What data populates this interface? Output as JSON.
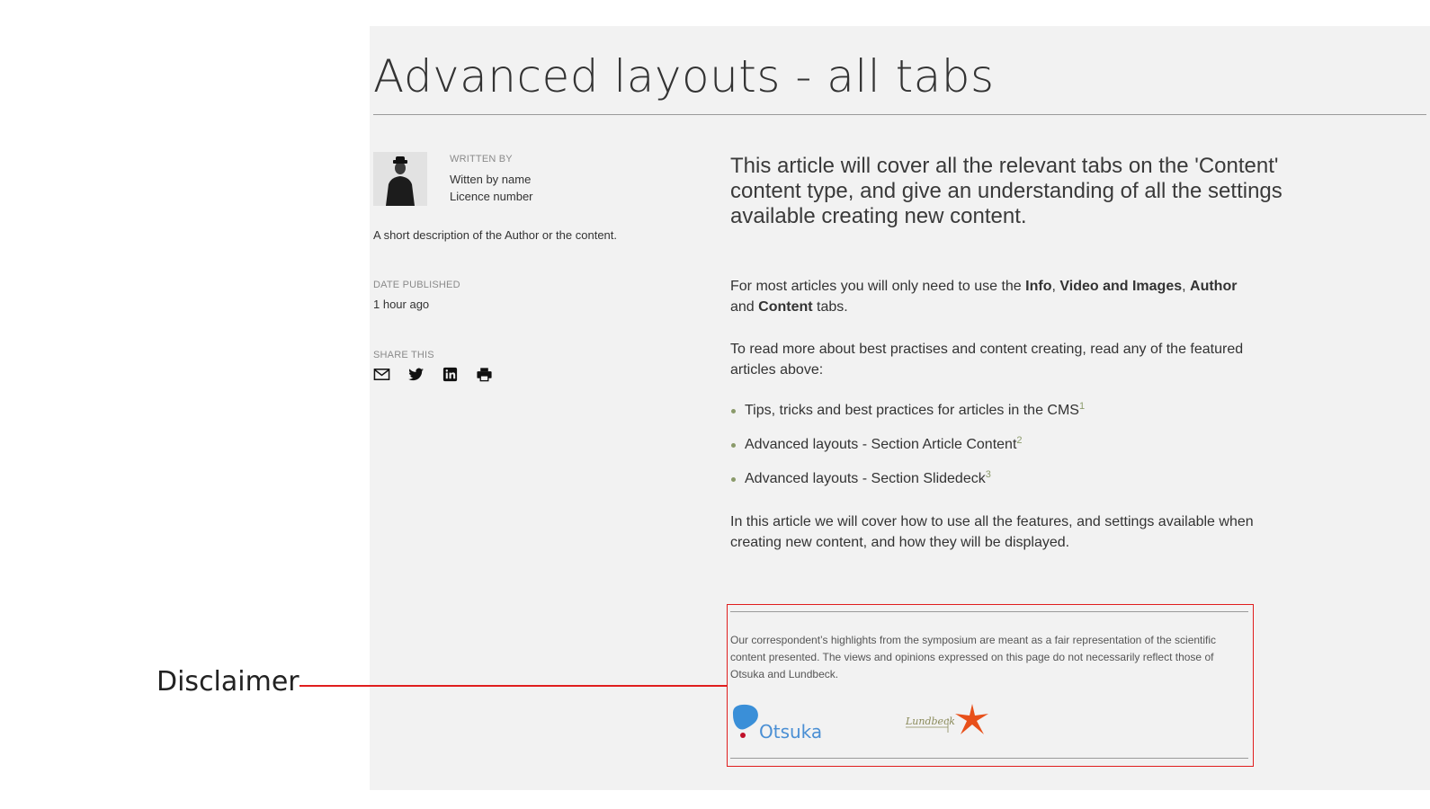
{
  "page": {
    "title": "Advanced layouts - all tabs"
  },
  "author": {
    "written_by_label": "WRITTEN BY",
    "name": "Witten by name",
    "licence": "Licence number",
    "description": "A short description of the Author or the content."
  },
  "published": {
    "label": "DATE PUBLISHED",
    "value": "1 hour ago"
  },
  "share": {
    "label": "SHARE THIS",
    "icons": [
      "mail-icon",
      "twitter-icon",
      "linkedin-icon",
      "print-icon"
    ]
  },
  "article": {
    "lead": "This article will cover all the relevant tabs on the 'Content' content type, and give an understanding of all the settings available creating new content.",
    "para1": {
      "t1": "For most articles you will only need to use the ",
      "b1": "Info",
      "t2": ", ",
      "b2": "Video and Images",
      "t3": ", ",
      "b3": "Author",
      "t4": " and ",
      "b4": "Content",
      "t5": " tabs."
    },
    "para2": "To read more about best practises and content creating, read any of the featured articles above:",
    "links": [
      {
        "text": "Tips, tricks and best practices for articles in the CMS",
        "ref": "1"
      },
      {
        "text": "Advanced layouts - Section Article Content",
        "ref": "2"
      },
      {
        "text": "Advanced layouts - Section Slidedeck",
        "ref": "3"
      }
    ],
    "para3": "In this article we will cover how to use all the features, and settings available when creating new content, and how they will be displayed."
  },
  "disclaimer": {
    "text": "Our correspondent’s highlights from the symposium are meant as a fair representation of the scientific content presented. The views and opinions expressed on this page do not necessarily reflect those of Otsuka and Lundbeck.",
    "logos": {
      "otsuka": "Otsuka",
      "lundbeck": "Lundbeck"
    }
  },
  "annotation": {
    "label": "Disclaimer",
    "color": "#e01e1e"
  },
  "colors": {
    "panel_bg": "#f2f2f2",
    "bullet": "#8a9a6a",
    "otsuka_blue": "#3a8fd8",
    "otsuka_red": "#c0102a",
    "lundbeck_orange": "#e8501a"
  }
}
